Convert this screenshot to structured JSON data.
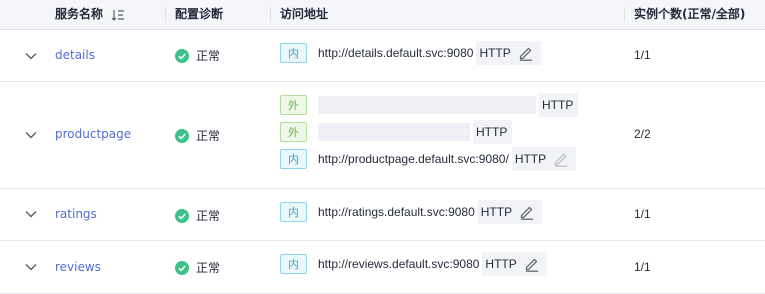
{
  "columns": {
    "service_name": "服务名称",
    "config_diagnosis": "配置诊断",
    "access_address": "访问地址",
    "instance_count": "实例个数(正常/全部)"
  },
  "colors": {
    "link": "#526ecc",
    "status_ok": "#3ec18a",
    "tag_internal": "#3aa3c9",
    "tag_external": "#6cb14f"
  },
  "rows": [
    {
      "name": "details",
      "diagnosis": "正常",
      "addresses": [
        {
          "tag": "内",
          "type": "internal",
          "url": "http://details.default.svc:9080",
          "protocol": "HTTP",
          "editable": true
        }
      ],
      "instances": "1/1"
    },
    {
      "name": "productpage",
      "diagnosis": "正常",
      "addresses": [
        {
          "tag": "外",
          "type": "external",
          "url": "",
          "protocol": "HTTP",
          "editable": false
        },
        {
          "tag": "外",
          "type": "external",
          "url": "",
          "protocol": "HTTP",
          "editable": false
        },
        {
          "tag": "内",
          "type": "internal",
          "url": "http://productpage.default.svc:9080/",
          "protocol": "HTTP",
          "editable": true,
          "disabled": true
        }
      ],
      "instances": "2/2"
    },
    {
      "name": "ratings",
      "diagnosis": "正常",
      "addresses": [
        {
          "tag": "内",
          "type": "internal",
          "url": "http://ratings.default.svc:9080",
          "protocol": "HTTP",
          "editable": true
        }
      ],
      "instances": "1/1"
    },
    {
      "name": "reviews",
      "diagnosis": "正常",
      "addresses": [
        {
          "tag": "内",
          "type": "internal",
          "url": "http://reviews.default.svc:9080",
          "protocol": "HTTP",
          "editable": true
        }
      ],
      "instances": "1/1"
    }
  ]
}
